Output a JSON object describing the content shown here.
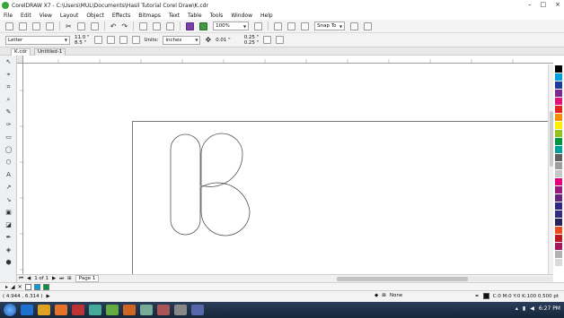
{
  "window": {
    "title": "CorelDRAW X7 - C:\\Users\\MUL\\Documents\\Hasil Tutorial Corel Draw\\K.cdr",
    "controls": [
      "–",
      "□",
      "×"
    ]
  },
  "menu": [
    "File",
    "Edit",
    "View",
    "Layout",
    "Object",
    "Effects",
    "Bitmaps",
    "Text",
    "Table",
    "Tools",
    "Window",
    "Help"
  ],
  "toolbar": {
    "zoom": "100%",
    "snap_to": "Snap To"
  },
  "property_bar": {
    "paper_size": "Letter",
    "width": "11.0 \"",
    "height": "8.5 \"",
    "units_label": "Units:",
    "units": "inches",
    "nudge": "0.01 \"",
    "dup_x": "0.25 \"",
    "dup_y": "0.25 \""
  },
  "tabs": [
    {
      "label": "K.cdr",
      "active": true
    },
    {
      "label": "Untitled-1",
      "active": false
    }
  ],
  "page_nav": {
    "page_count": "1 of 1",
    "page_tab": "Page 1"
  },
  "status": {
    "coords": "( 4.944 , 6.314 )",
    "fill_label": "None",
    "outline": "C:0 M:0 Y:0 K:100  0.500 pt"
  },
  "taskbar": {
    "time": "6:27 PM"
  },
  "palette_colors": [
    "#ffffff",
    "#000000",
    "#00a0e3",
    "#1a3a9c",
    "#7a2b8f",
    "#e0147a",
    "#e52421",
    "#f39200",
    "#ffed00",
    "#95c11f",
    "#009640",
    "#00a19a",
    "#5f5f5f",
    "#9d9d9c",
    "#c6c6c6",
    "#e6007e",
    "#951b81",
    "#662483",
    "#312783",
    "#2d2e83",
    "#29235c",
    "#e94e1b",
    "#be1622",
    "#a3195b",
    "#b1b1b1",
    "#dadada"
  ],
  "doc_palette": [
    "#ffffff",
    "#00a0e3",
    "#009640"
  ],
  "icons": {
    "toolbox": [
      "pick-icon",
      "shape-icon",
      "crop-icon",
      "zoom-icon",
      "freehand-icon",
      "artistic-media-icon",
      "rectangle-icon",
      "ellipse-icon",
      "polygon-icon",
      "text-icon",
      "parallel-dimension-icon",
      "connector-icon",
      "drop-shadow-icon",
      "transparency-icon",
      "color-eyedropper-icon",
      "interactive-fill-icon",
      "smart-fill-icon"
    ]
  }
}
